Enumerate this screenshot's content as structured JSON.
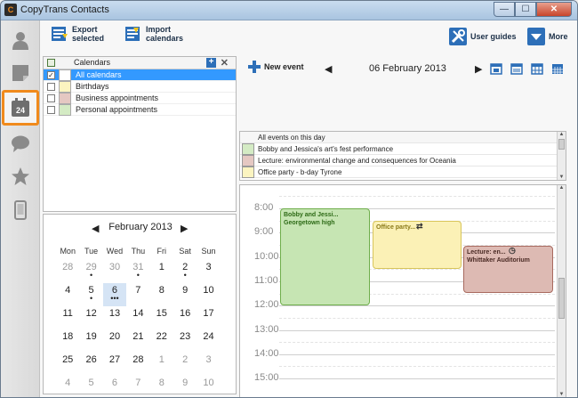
{
  "window": {
    "title": "CopyTrans Contacts",
    "app_icon_text": "C"
  },
  "rail": {
    "items": [
      "contacts-icon",
      "notes-icon",
      "calendar-icon",
      "messages-icon",
      "favorites-icon",
      "phone-icon"
    ],
    "active": "calendar-icon",
    "calendar_badge": "24"
  },
  "toolbar": {
    "export_label": "Export\nselected",
    "import_label": "Import\ncalendars",
    "guides_label": "User guides",
    "more_label": "More"
  },
  "calendars": {
    "header": "Calendars",
    "items": [
      {
        "label": "All calendars",
        "checked": true,
        "color": "#ffffff",
        "selected": true
      },
      {
        "label": "Birthdays",
        "checked": false,
        "color": "#fbf4c0"
      },
      {
        "label": "Business appointments",
        "checked": false,
        "color": "#e5c8c2"
      },
      {
        "label": "Personal appointments",
        "checked": false,
        "color": "#d4ebc4"
      }
    ]
  },
  "mini_calendar": {
    "month_label": "February 2013",
    "weekdays": [
      "Mon",
      "Tue",
      "Wed",
      "Thu",
      "Fri",
      "Sat",
      "Sun"
    ],
    "weeks": [
      [
        [
          "28",
          "dim",
          ""
        ],
        [
          "29",
          "dim",
          "•"
        ],
        [
          "30",
          "dim",
          ""
        ],
        [
          "31",
          "dim",
          "•"
        ],
        [
          "1",
          "",
          ""
        ],
        [
          "2",
          "",
          "•"
        ],
        [
          "3",
          "",
          ""
        ]
      ],
      [
        [
          "4",
          "",
          ""
        ],
        [
          "5",
          "",
          "•"
        ],
        [
          "6",
          "today",
          "•••"
        ],
        [
          "7",
          "",
          ""
        ],
        [
          "8",
          "",
          ""
        ],
        [
          "9",
          "",
          ""
        ],
        [
          "10",
          "",
          ""
        ]
      ],
      [
        [
          "11",
          "",
          ""
        ],
        [
          "12",
          "",
          ""
        ],
        [
          "13",
          "",
          ""
        ],
        [
          "14",
          "",
          ""
        ],
        [
          "15",
          "",
          ""
        ],
        [
          "16",
          "",
          ""
        ],
        [
          "17",
          "",
          ""
        ]
      ],
      [
        [
          "18",
          "",
          ""
        ],
        [
          "19",
          "",
          ""
        ],
        [
          "20",
          "",
          ""
        ],
        [
          "21",
          "",
          ""
        ],
        [
          "22",
          "",
          ""
        ],
        [
          "23",
          "",
          ""
        ],
        [
          "24",
          "",
          ""
        ]
      ],
      [
        [
          "25",
          "",
          ""
        ],
        [
          "26",
          "",
          ""
        ],
        [
          "27",
          "",
          ""
        ],
        [
          "28",
          "",
          ""
        ],
        [
          "1",
          "dim",
          ""
        ],
        [
          "2",
          "dim",
          ""
        ],
        [
          "3",
          "dim",
          ""
        ]
      ],
      [
        [
          "4",
          "dim",
          ""
        ],
        [
          "5",
          "dim",
          ""
        ],
        [
          "6",
          "dim",
          ""
        ],
        [
          "7",
          "dim",
          ""
        ],
        [
          "8",
          "dim",
          ""
        ],
        [
          "9",
          "dim",
          ""
        ],
        [
          "10",
          "dim",
          ""
        ]
      ]
    ]
  },
  "main": {
    "new_event_label": "New event",
    "date_label": "06 February 2013",
    "view_icons": [
      "day-view-icon",
      "week-view-icon",
      "month-view-icon",
      "year-view-icon"
    ],
    "all_events_header": "All events on this day",
    "all_day_events": [
      {
        "title": "Bobby and Jessica's art's fest performance",
        "color": "#d4ebc4"
      },
      {
        "title": "Lecture: environmental change and consequences for Oceania",
        "color": "#e5c8c2"
      },
      {
        "title": "Office party - b-day Tyrone",
        "color": "#fbf4c0"
      }
    ]
  },
  "day_view": {
    "hours": [
      "8:00",
      "9:00",
      "10:00",
      "11:00",
      "12:00",
      "13:00",
      "14:00",
      "15:00"
    ],
    "appointments": [
      {
        "title": "Bobby and Jessi...",
        "location": "Georgetown high",
        "bg": "#c6e5b3",
        "border": "#6fae4c",
        "text": "#2d6a16"
      },
      {
        "title": "Office party...",
        "location": "",
        "bg": "#fbf1b6",
        "border": "#d8c55a",
        "text": "#8a7a1a"
      },
      {
        "title": "Lecture: en...",
        "location": "Whittaker Auditorium",
        "bg": "#ddbab3",
        "border": "#a86a5f",
        "text": "#4a2a24"
      }
    ]
  }
}
